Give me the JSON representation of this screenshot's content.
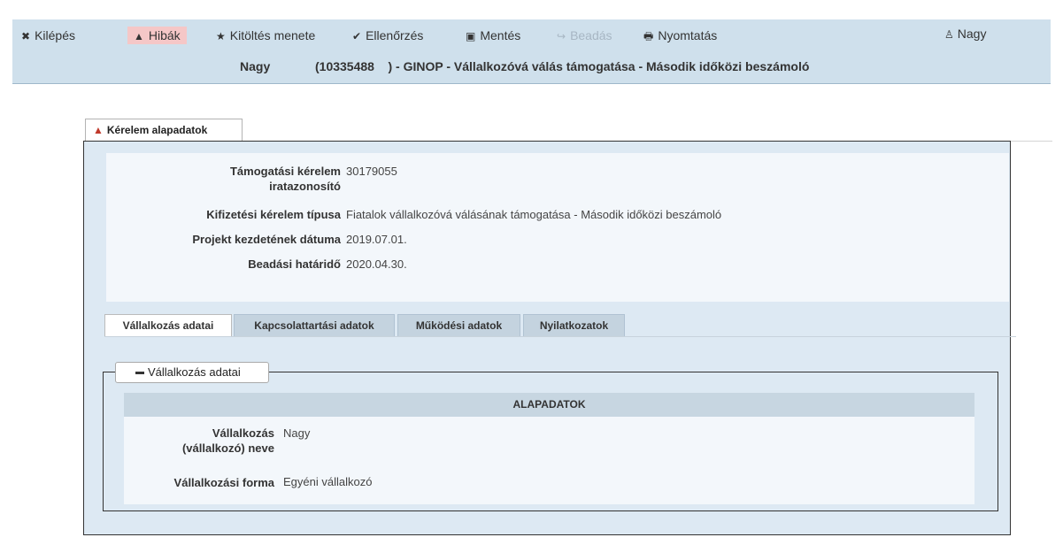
{
  "toolbar": {
    "items": [
      {
        "icon": "✖",
        "label": "Kilépés"
      },
      {
        "icon": "▲",
        "label": "Hibák"
      },
      {
        "icon": "★",
        "label": "Kitöltés menete"
      },
      {
        "icon": "✔",
        "label": "Ellenőrzés"
      },
      {
        "icon": "▣",
        "label": "Mentés"
      },
      {
        "icon": "↪",
        "label": "Beadás"
      },
      {
        "icon": "🖶",
        "label": "Nyomtatás"
      }
    ],
    "user": {
      "icon": "♙",
      "label": "Nagy"
    },
    "title": {
      "name": "Nagy",
      "rest": "(10335488    ) - GINOP - Vállalkozóvá válás támogatása - Második időközi beszámoló"
    }
  },
  "top_tab": {
    "label": "Kérelem alapadatok"
  },
  "info": {
    "rows": [
      {
        "label1": "Támogatási kérelem",
        "label2": "iratazonosító",
        "value": "30179055"
      },
      {
        "label": "Kifizetési kérelem típusa",
        "value": "Fiatalok vállalkozóvá válásának támogatása - Második időközi beszámoló"
      },
      {
        "label": "Projekt kezdetének dátuma",
        "value": "2019.07.01."
      },
      {
        "label": "Beadási határidő",
        "value": "2020.04.30."
      }
    ]
  },
  "subtabs": [
    "Vállalkozás adatai",
    "Kapcsolattartási adatok",
    "Működési adatok",
    "Nyilatkozatok"
  ],
  "section": {
    "legend": "Vállalkozás adatai",
    "header": "ALAPADATOK",
    "rows": [
      {
        "label1": "Vállalkozás",
        "label2": "(vállalkozó) neve",
        "value": "Nagy"
      },
      {
        "label": "Vállalkozási forma",
        "value": "Egyéni vállalkozó"
      }
    ]
  }
}
